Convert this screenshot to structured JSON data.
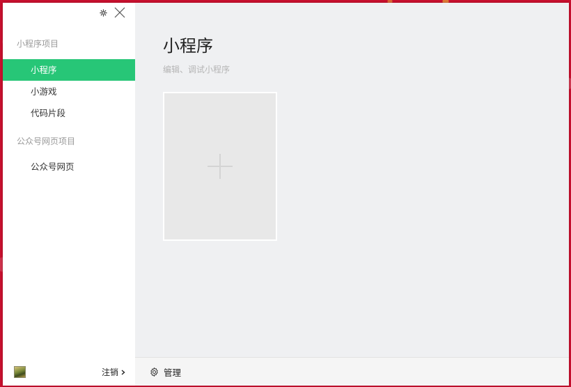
{
  "sidebar": {
    "sections": [
      {
        "title": "小程序项目",
        "items": [
          {
            "label": "小程序",
            "active": true
          },
          {
            "label": "小游戏",
            "active": false
          },
          {
            "label": "代码片段",
            "active": false
          }
        ]
      },
      {
        "title": "公众号网页项目",
        "items": [
          {
            "label": "公众号网页",
            "active": false
          }
        ]
      }
    ],
    "footer": {
      "logout_label": "注销",
      "logout_icon": "chevron-right-icon"
    },
    "window_controls": {
      "settings_icon": "gear-icon",
      "close_icon": "close-icon"
    }
  },
  "main": {
    "title": "小程序",
    "subtitle": "编辑、调试小程序",
    "add_card_icon": "plus-icon",
    "footer": {
      "manage_label": "管理",
      "manage_icon": "gear-icon"
    }
  },
  "colors": {
    "accent": "#27c677",
    "background": "#c8102e",
    "main_bg": "#eff0f2"
  }
}
